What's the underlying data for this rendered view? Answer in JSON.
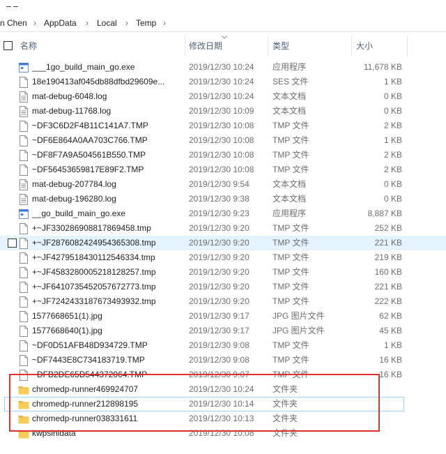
{
  "breadcrumb": [
    "n Chen",
    "AppData",
    "Local",
    "Temp"
  ],
  "columns": {
    "name": "名称",
    "modified": "修改日期",
    "type": "类型",
    "size": "大小"
  },
  "files": [
    {
      "name": "___1go_build_main_go.exe",
      "date": "2019/12/30 10:24",
      "type": "应用程序",
      "size": "11,678 KB",
      "icon": "exe-icon"
    },
    {
      "name": "18e190413af045db88dfbd29609e...",
      "date": "2019/12/30 10:24",
      "type": "SES 文件",
      "size": "1 KB",
      "icon": "file-icon"
    },
    {
      "name": "mat-debug-6048.log",
      "date": "2019/12/30 10:24",
      "type": "文本文档",
      "size": "0 KB",
      "icon": "text-file-icon"
    },
    {
      "name": "mat-debug-11768.log",
      "date": "2019/12/30 10:09",
      "type": "文本文档",
      "size": "0 KB",
      "icon": "text-file-icon"
    },
    {
      "name": "~DF3C6D2F4B11C141A7.TMP",
      "date": "2019/12/30 10:08",
      "type": "TMP 文件",
      "size": "2 KB",
      "icon": "file-icon"
    },
    {
      "name": "~DF6E864A0AA703C766.TMP",
      "date": "2019/12/30 10:08",
      "type": "TMP 文件",
      "size": "1 KB",
      "icon": "file-icon"
    },
    {
      "name": "~DF8F7A9A504561B550.TMP",
      "date": "2019/12/30 10:08",
      "type": "TMP 文件",
      "size": "2 KB",
      "icon": "file-icon"
    },
    {
      "name": "~DF56453659817E89F2.TMP",
      "date": "2019/12/30 10:08",
      "type": "TMP 文件",
      "size": "2 KB",
      "icon": "file-icon"
    },
    {
      "name": "mat-debug-207784.log",
      "date": "2019/12/30 9:54",
      "type": "文本文档",
      "size": "0 KB",
      "icon": "text-file-icon"
    },
    {
      "name": "mat-debug-196280.log",
      "date": "2019/12/30 9:38",
      "type": "文本文档",
      "size": "0 KB",
      "icon": "text-file-icon"
    },
    {
      "name": "__go_build_main_go.exe",
      "date": "2019/12/30 9:23",
      "type": "应用程序",
      "size": "8,887 KB",
      "icon": "exe-icon"
    },
    {
      "name": "+~JF330286908817869458.tmp",
      "date": "2019/12/30 9:20",
      "type": "TMP 文件",
      "size": "252 KB",
      "icon": "file-icon"
    },
    {
      "name": "+~JF2876082424954365308.tmp",
      "date": "2019/12/30 9:20",
      "type": "TMP 文件",
      "size": "221 KB",
      "icon": "file-icon"
    },
    {
      "name": "+~JF4279518430112546334.tmp",
      "date": "2019/12/30 9:20",
      "type": "TMP 文件",
      "size": "219 KB",
      "icon": "file-icon"
    },
    {
      "name": "+~JF4583280005218128257.tmp",
      "date": "2019/12/30 9:20",
      "type": "TMP 文件",
      "size": "160 KB",
      "icon": "file-icon"
    },
    {
      "name": "+~JF6410735452057672773.tmp",
      "date": "2019/12/30 9:20",
      "type": "TMP 文件",
      "size": "221 KB",
      "icon": "file-icon"
    },
    {
      "name": "+~JF7242433187673493932.tmp",
      "date": "2019/12/30 9:20",
      "type": "TMP 文件",
      "size": "222 KB",
      "icon": "file-icon"
    },
    {
      "name": "1577668651(1).jpg",
      "date": "2019/12/30 9:17",
      "type": "JPG 图片文件",
      "size": "62 KB",
      "icon": "file-icon"
    },
    {
      "name": "1577668640(1).jpg",
      "date": "2019/12/30 9:17",
      "type": "JPG 图片文件",
      "size": "45 KB",
      "icon": "file-icon"
    },
    {
      "name": "~DF0D51AFB48D934729.TMP",
      "date": "2019/12/30 9:08",
      "type": "TMP 文件",
      "size": "1 KB",
      "icon": "file-icon"
    },
    {
      "name": "~DF7443E8C734183719.TMP",
      "date": "2019/12/30 9:08",
      "type": "TMP 文件",
      "size": "16 KB",
      "icon": "file-icon"
    },
    {
      "name": "~DFB2DE65D544372064.TMP",
      "date": "2019/12/30 9:07",
      "type": "TMP 文件",
      "size": "16 KB",
      "icon": "file-icon"
    },
    {
      "name": "chromedp-runner469924707",
      "date": "2019/12/30 10:24",
      "type": "文件夹",
      "size": "",
      "icon": "folder-icon"
    },
    {
      "name": "chromedp-runner212898195",
      "date": "2019/12/30 10:14",
      "type": "文件夹",
      "size": "",
      "icon": "folder-icon"
    },
    {
      "name": "chromedp-runner038331611",
      "date": "2019/12/30 10:13",
      "type": "文件夹",
      "size": "",
      "icon": "folder-icon"
    },
    {
      "name": "kwpsinidata",
      "date": "2019/12/30 10:08",
      "type": "文件夹",
      "size": "",
      "icon": "folder-icon"
    }
  ],
  "hover_row_index": 12,
  "selected_row_index": 23,
  "colors": {
    "highlight_border": "#e0302e",
    "hover_bg": "#e5f3ff",
    "folder": "#f0c64a"
  }
}
